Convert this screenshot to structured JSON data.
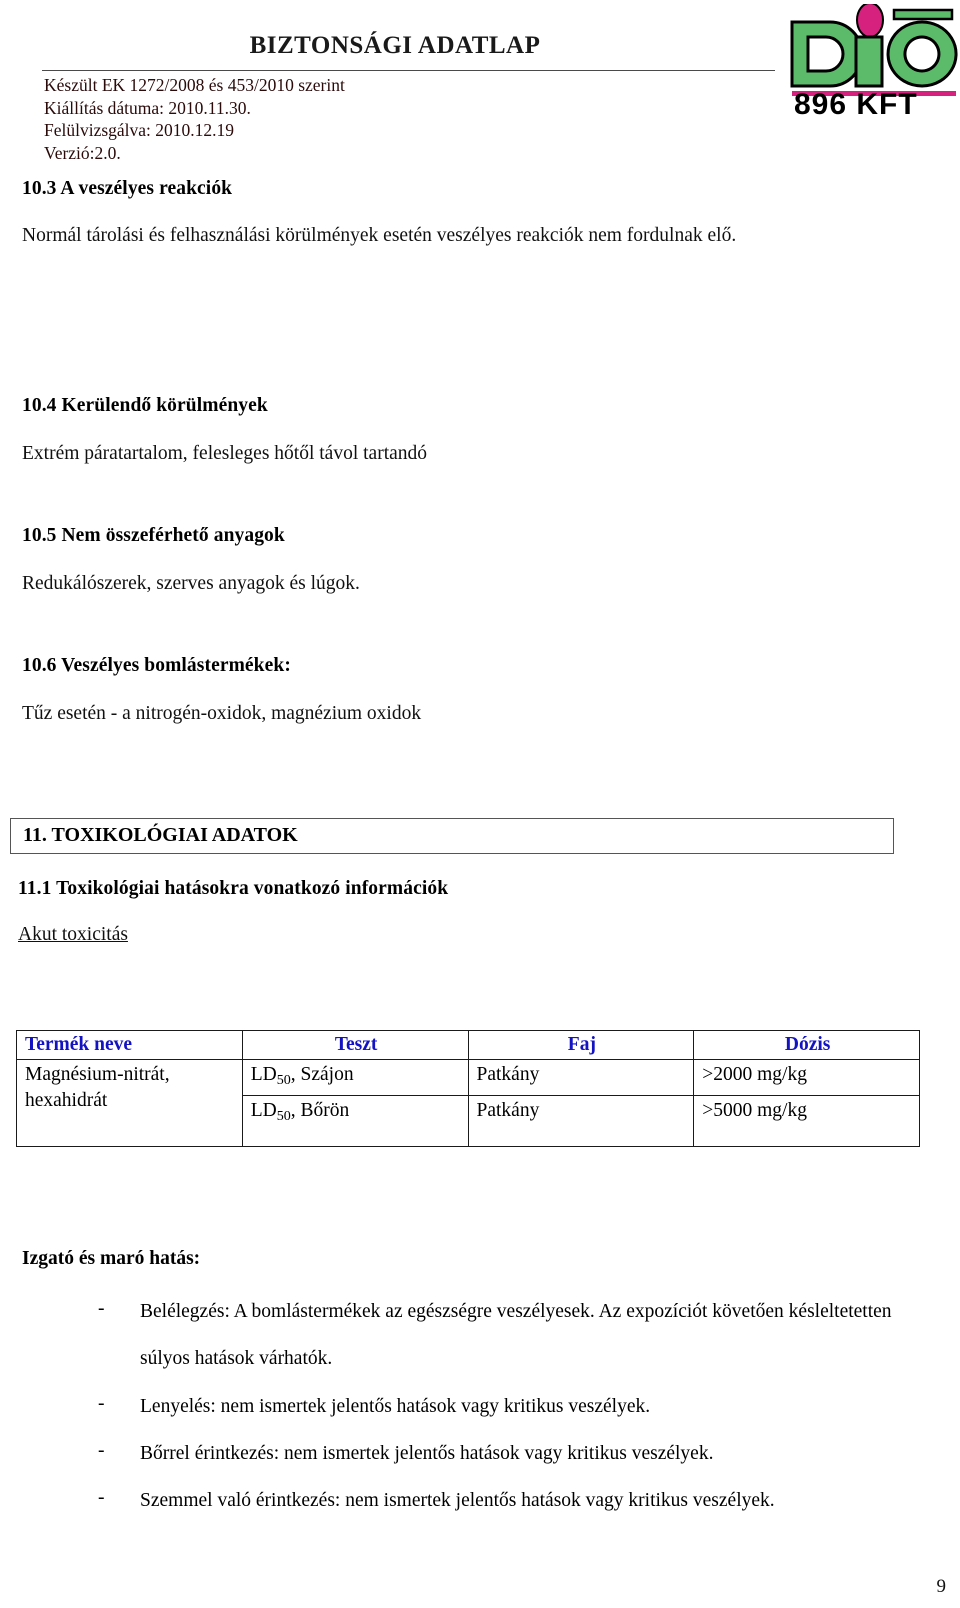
{
  "document": {
    "title": "BIZTONSÁGI ADATLAP",
    "meta_lines": [
      "Készült EK 1272/2008 és 453/2010 szerint",
      "Kiállítás dátuma: 2010.11.30.",
      "Felülvizsgálva: 2010.12.19",
      "Verzió:2.0."
    ],
    "page_number": "9"
  },
  "logo": {
    "wordmark": "DIO",
    "subtext": "896 KFT",
    "green": "#5cbb6a",
    "magenta": "#d6217f",
    "black": "#000000"
  },
  "sections": [
    {
      "id": "10.3",
      "heading": "10.3 A veszélyes reakciók",
      "body": "Normál tárolási és felhasználási körülmények esetén veszélyes reakciók nem fordulnak elő."
    },
    {
      "id": "10.4",
      "heading": "10.4 Kerülendő körülmények",
      "body": "Extrém páratartalom, felesleges hőtől távol tartandó"
    },
    {
      "id": "10.5",
      "heading": "10.5 Nem összeférhető anyagok",
      "body": "Redukálószerek, szerves anyagok és lúgok."
    },
    {
      "id": "10.6",
      "heading": "10.6 Veszélyes bomlástermékek:",
      "body": "Tűz esetén - a nitrogén-oxidok, magnézium oxidok"
    }
  ],
  "section11": {
    "box_title": "11. TOXIKOLÓGIAI ADATOK",
    "subheading": "11.1 Toxikológiai hatásokra vonatkozó információk",
    "subsubheading": "Akut toxicitás"
  },
  "table": {
    "headers": [
      "Termék neve",
      "Teszt",
      "Faj",
      "Dózis"
    ],
    "header_color": "#1313c4",
    "rows": [
      {
        "product": "Magnésium-nitrát, hexahidrát",
        "test_prefix": "LD",
        "test_sub": "50",
        "test_suffix": ", Szájon",
        "species": "Patkány",
        "dose": ">2000 mg/kg"
      },
      {
        "product": "",
        "test_prefix": "LD",
        "test_sub": "50",
        "test_suffix": ", Bőrön",
        "species": "Patkány",
        "dose": ">5000 mg/kg"
      }
    ]
  },
  "effects": {
    "heading": "Izgató és maró hatás:",
    "dash": "-",
    "items": [
      "Belélegzés: A bomlástermékek az egészségre veszélyesek. Az expozíciót követően késleltetetten súlyos hatások várhatók.",
      "Lenyelés: nem ismertek jelentős hatások vagy kritikus veszélyek.",
      "Bőrrel érintkezés: nem ismertek jelentős hatások vagy kritikus veszélyek.",
      "Szemmel való érintkezés: nem ismertek jelentős hatások vagy kritikus veszélyek."
    ]
  }
}
